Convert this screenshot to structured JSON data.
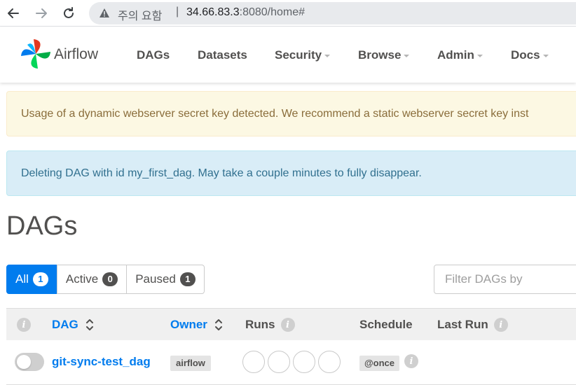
{
  "browser": {
    "security_warning": "주의 요함",
    "separator": "|",
    "url_host": "34.66.83.3",
    "url_rest": ":8080/home#"
  },
  "navbar": {
    "brand": "Airflow",
    "items": [
      {
        "label": "DAGs",
        "has_caret": false
      },
      {
        "label": "Datasets",
        "has_caret": false
      },
      {
        "label": "Security",
        "has_caret": true
      },
      {
        "label": "Browse",
        "has_caret": true
      },
      {
        "label": "Admin",
        "has_caret": true
      },
      {
        "label": "Docs",
        "has_caret": true
      }
    ]
  },
  "alerts": {
    "warning": "Usage of a dynamic webserver secret key detected. We recommend a static webserver secret key inst",
    "info": "Deleting DAG with id my_first_dag. May take a couple minutes to fully disappear."
  },
  "page_title": "DAGs",
  "status_filter": {
    "all": {
      "label": "All",
      "count": "1"
    },
    "active": {
      "label": "Active",
      "count": "0"
    },
    "paused": {
      "label": "Paused",
      "count": "1"
    }
  },
  "search": {
    "placeholder": "Filter DAGs by"
  },
  "table": {
    "headers": {
      "info": "i",
      "dag": "DAG",
      "owner": "Owner",
      "runs": "Runs",
      "schedule": "Schedule",
      "last_run": "Last Run"
    },
    "rows": [
      {
        "dag_id": "git-sync-test_dag",
        "owner": "airflow",
        "schedule": "@once",
        "paused": true
      }
    ]
  },
  "colors": {
    "accent": "#017cee",
    "text": "#51504f",
    "warning_bg": "#fcf8e3",
    "info_bg": "#d9edf7"
  }
}
